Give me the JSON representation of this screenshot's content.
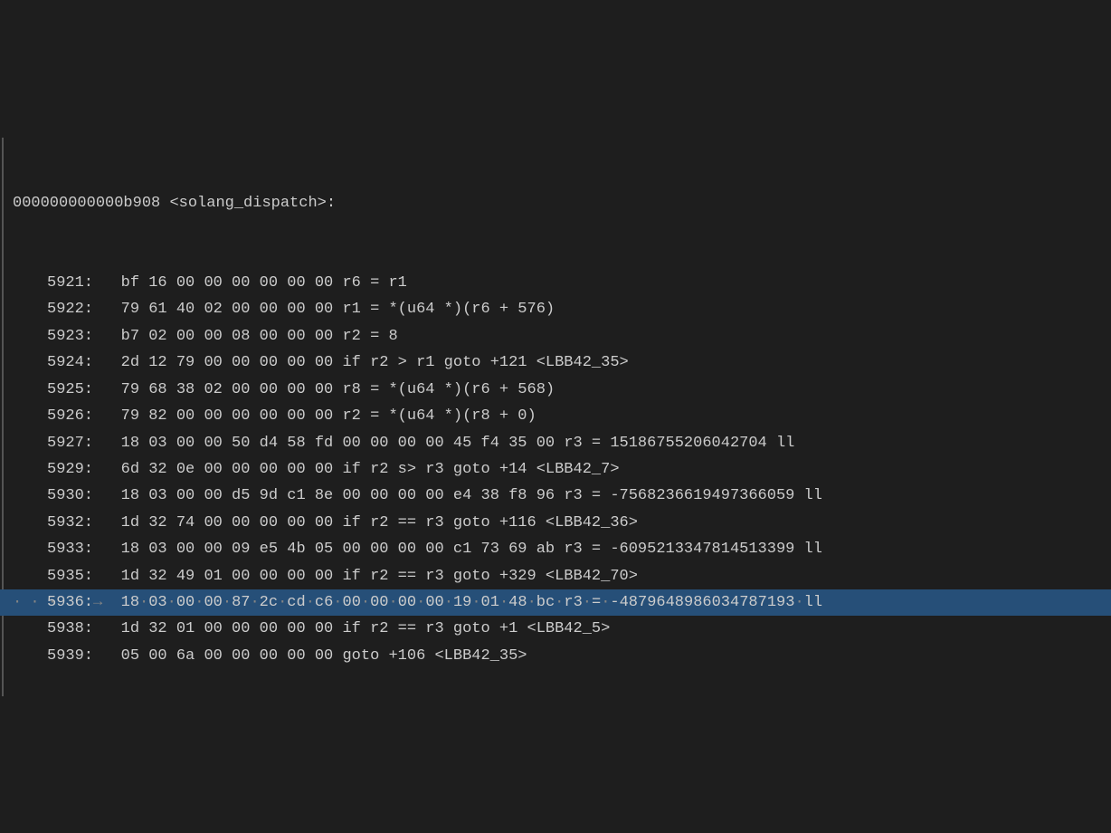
{
  "header": {
    "address": "000000000000b908",
    "symbol": "<solang_dispatch>:"
  },
  "lines": [
    {
      "num": "5921:",
      "hex": "bf 16 00 00 00 00 00 00",
      "asm": "r6 = r1",
      "hl": false
    },
    {
      "num": "5922:",
      "hex": "79 61 40 02 00 00 00 00",
      "asm": "r1 = *(u64 *)(r6 + 576)",
      "hl": false
    },
    {
      "num": "5923:",
      "hex": "b7 02 00 00 08 00 00 00",
      "asm": "r2 = 8",
      "hl": false
    },
    {
      "num": "5924:",
      "hex": "2d 12 79 00 00 00 00 00",
      "asm": "if r2 > r1 goto +121 <LBB42_35>",
      "hl": false
    },
    {
      "num": "5925:",
      "hex": "79 68 38 02 00 00 00 00",
      "asm": "r8 = *(u64 *)(r6 + 568)",
      "hl": false
    },
    {
      "num": "5926:",
      "hex": "79 82 00 00 00 00 00 00",
      "asm": "r2 = *(u64 *)(r8 + 0)",
      "hl": false
    },
    {
      "num": "5927:",
      "hex": "18 03 00 00 50 d4 58 fd 00 00 00 00 45 f4 35 00",
      "asm": "r3 = 15186755206042704 ll",
      "hl": false
    },
    {
      "num": "5929:",
      "hex": "6d 32 0e 00 00 00 00 00",
      "asm": "if r2 s> r3 goto +14 <LBB42_7>",
      "hl": false
    },
    {
      "num": "5930:",
      "hex": "18 03 00 00 d5 9d c1 8e 00 00 00 00 e4 38 f8 96",
      "asm": "r3 = -7568236619497366059 ll",
      "hl": false
    },
    {
      "num": "5932:",
      "hex": "1d 32 74 00 00 00 00 00",
      "asm": "if r2 == r3 goto +116 <LBB42_36>",
      "hl": false
    },
    {
      "num": "5933:",
      "hex": "18 03 00 00 09 e5 4b 05 00 00 00 00 c1 73 69 ab",
      "asm": "r3 = -6095213347814513399 ll",
      "hl": false
    },
    {
      "num": "5935:",
      "hex": "1d 32 49 01 00 00 00 00",
      "asm": "if r2 == r3 goto +329 <LBB42_70>",
      "hl": false
    },
    {
      "num": "5936:",
      "hex": "18 03 00 00 87 2c cd c6 00 00 00 00 19 01 48 bc",
      "asm": "r3 = -4879648986034787193 ll",
      "hl": true
    },
    {
      "num": "5938:",
      "hex": "1d 32 01 00 00 00 00 00",
      "asm": "if r2 == r3 goto +1 <LBB42_5>",
      "hl": false
    },
    {
      "num": "5939:",
      "hex": "05 00 6a 00 00 00 00 00",
      "asm": "goto +106 <LBB42_35>",
      "hl": false
    }
  ]
}
